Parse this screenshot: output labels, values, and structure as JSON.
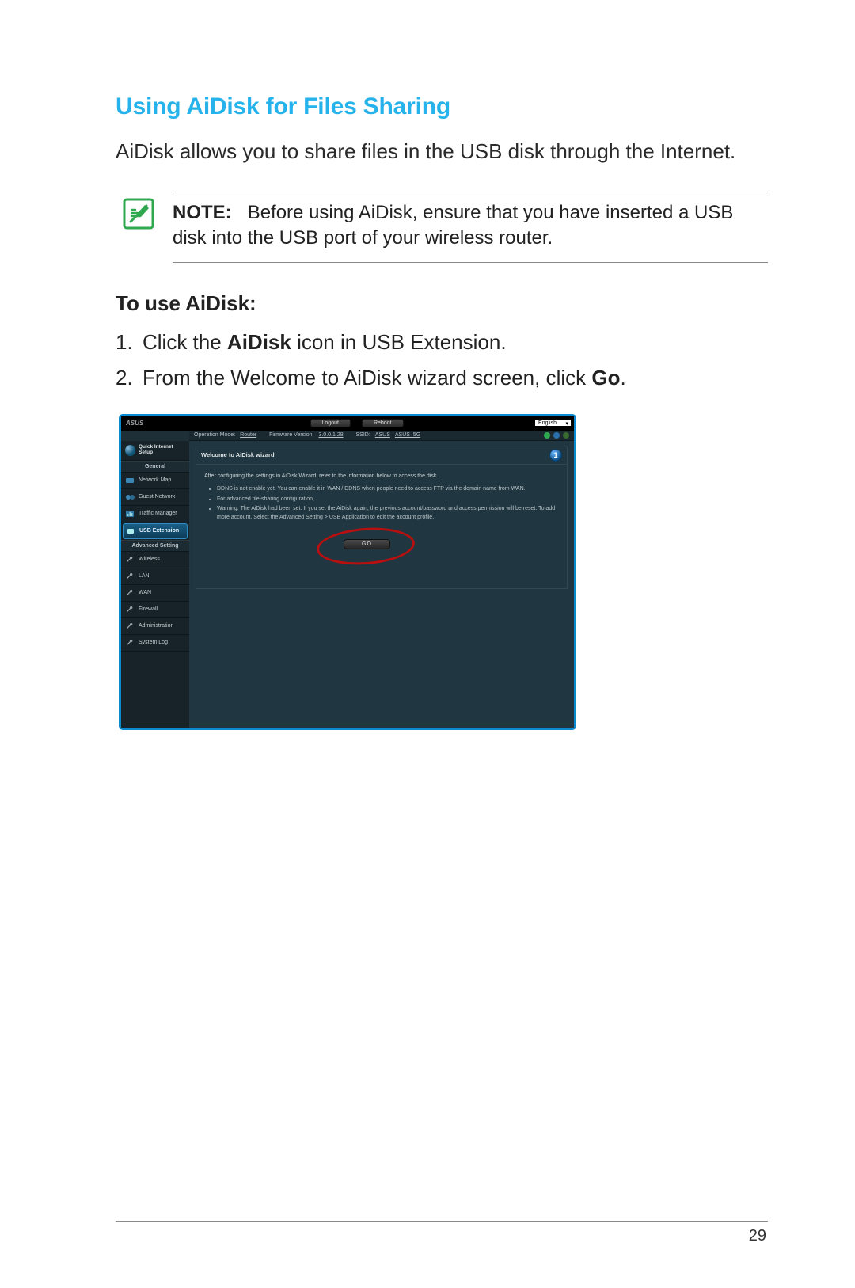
{
  "doc": {
    "heading": "Using AiDisk for Files Sharing",
    "intro": "AiDisk allows you to share files in the USB disk through the Internet.",
    "note_label": "NOTE:",
    "note_text": "Before using AiDisk, ensure that you have inserted a USB disk into the USB port of your wireless router.",
    "subheading": "To use AiDisk:",
    "steps": [
      {
        "n": "1.",
        "pre": "Click the ",
        "bold": "AiDisk",
        "post": " icon in USB Extension."
      },
      {
        "n": "2.",
        "pre": "From the Welcome to AiDisk wizard screen, click ",
        "bold": "Go",
        "post": "."
      }
    ],
    "page_number": "29"
  },
  "shot": {
    "brand": "ASUS",
    "top_buttons": {
      "logout": "Logout",
      "reboot": "Reboot"
    },
    "language": "English",
    "status": {
      "op_mode_label": "Operation Mode:",
      "op_mode_value": "Router",
      "fw_label": "Firmware Version:",
      "fw_value": "3.0.0.1.28",
      "ssid_label": "SSID:",
      "ssid1": "ASUS",
      "ssid2": "ASUS_5G"
    },
    "sidebar": {
      "quick": "Quick Internet Setup",
      "section_general": "General",
      "section_advanced": "Advanced Setting",
      "general": [
        "Network Map",
        "Guest Network",
        "Traffic Manager",
        "USB Extension"
      ],
      "advanced": [
        "Wireless",
        "LAN",
        "WAN",
        "Firewall",
        "Administration",
        "System Log"
      ]
    },
    "wizard": {
      "title": "Welcome to AiDisk wizard",
      "step_badge": "1",
      "lead": "After configuring the settings in AiDisk Wizard, refer to the information below to access the disk.",
      "bullets": [
        "DDNS is not enable yet. You can enable it in WAN / DDNS when people need to access FTP via the domain name from WAN.",
        "For advanced file-sharing configuration,",
        "Warning: The AiDisk had been set. If you set the AiDisk again, the previous account/password and access permission will be reset. To add more account, Select the Advanced Setting > USB Application to edit the account profile."
      ],
      "go": "GO"
    }
  }
}
